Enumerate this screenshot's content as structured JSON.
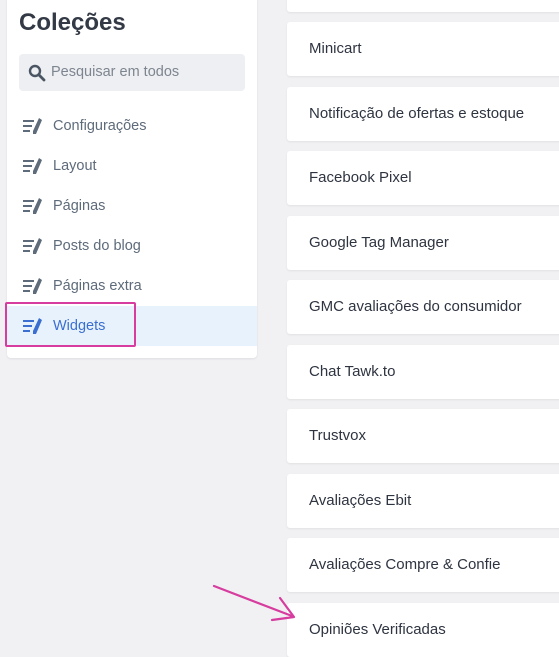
{
  "sidebar": {
    "title": "Coleções",
    "search": {
      "placeholder": "Pesquisar em todos"
    },
    "items": [
      {
        "label": "Configurações"
      },
      {
        "label": "Layout"
      },
      {
        "label": "Páginas"
      },
      {
        "label": "Posts do blog"
      },
      {
        "label": "Páginas extra"
      },
      {
        "label": "Widgets",
        "active": true
      }
    ]
  },
  "widgets": [
    {
      "label": "Minicart"
    },
    {
      "label": "Notificação de ofertas e estoque"
    },
    {
      "label": "Facebook Pixel"
    },
    {
      "label": "Google Tag Manager"
    },
    {
      "label": "GMC avaliações do consumidor"
    },
    {
      "label": "Chat Tawk.to"
    },
    {
      "label": "Trustvox"
    },
    {
      "label": "Avaliações Ebit"
    },
    {
      "label": "Avaliações Compre & Confie"
    },
    {
      "label": "Opiniões Verificadas"
    }
  ],
  "colors": {
    "accent": "#3a6fd1",
    "highlight": "#d63d9e",
    "active_bg": "#e8f2fd"
  }
}
